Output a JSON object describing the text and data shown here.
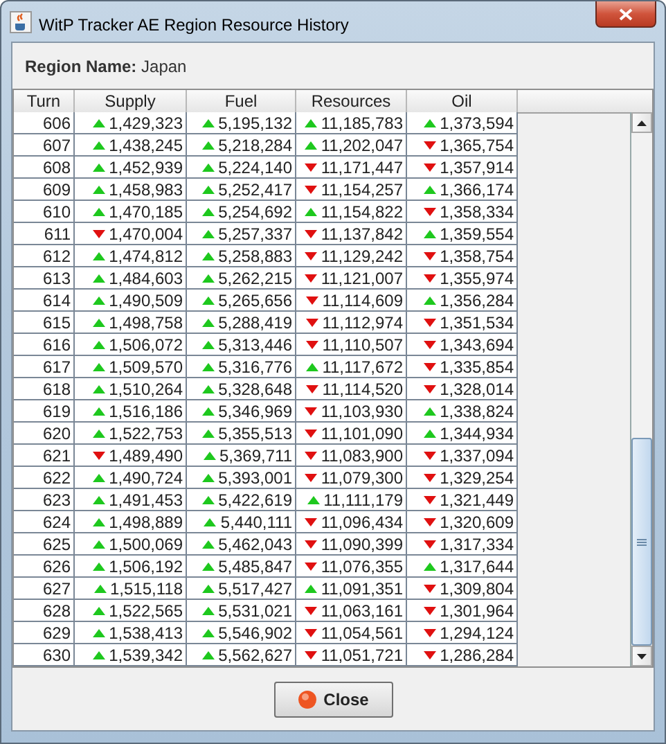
{
  "window": {
    "title": "WitP Tracker AE Region Resource History"
  },
  "region": {
    "label": "Region Name:",
    "value": "Japan"
  },
  "table": {
    "columns": [
      "Turn",
      "Supply",
      "Fuel",
      "Resources",
      "Oil"
    ],
    "rows": [
      {
        "cells": [
          {
            "value": "606"
          },
          {
            "value": "1,429,323",
            "rising": true
          },
          {
            "value": "5,195,132",
            "rising": true
          },
          {
            "value": "11,185,783",
            "rising": true
          },
          {
            "value": "1,373,594",
            "rising": true
          }
        ]
      },
      {
        "cells": [
          {
            "value": "607"
          },
          {
            "value": "1,438,245",
            "rising": true
          },
          {
            "value": "5,218,284",
            "rising": true
          },
          {
            "value": "11,202,047",
            "rising": true
          },
          {
            "value": "1,365,754",
            "rising": false
          }
        ]
      },
      {
        "cells": [
          {
            "value": "608"
          },
          {
            "value": "1,452,939",
            "rising": true
          },
          {
            "value": "5,224,140",
            "rising": true
          },
          {
            "value": "11,171,447",
            "rising": false
          },
          {
            "value": "1,357,914",
            "rising": false
          }
        ]
      },
      {
        "cells": [
          {
            "value": "609"
          },
          {
            "value": "1,458,983",
            "rising": true
          },
          {
            "value": "5,252,417",
            "rising": true
          },
          {
            "value": "11,154,257",
            "rising": false
          },
          {
            "value": "1,366,174",
            "rising": true
          }
        ]
      },
      {
        "cells": [
          {
            "value": "610"
          },
          {
            "value": "1,470,185",
            "rising": true
          },
          {
            "value": "5,254,692",
            "rising": true
          },
          {
            "value": "11,154,822",
            "rising": true
          },
          {
            "value": "1,358,334",
            "rising": false
          }
        ]
      },
      {
        "cells": [
          {
            "value": "611"
          },
          {
            "value": "1,470,004",
            "rising": false
          },
          {
            "value": "5,257,337",
            "rising": true
          },
          {
            "value": "11,137,842",
            "rising": false
          },
          {
            "value": "1,359,554",
            "rising": true
          }
        ]
      },
      {
        "cells": [
          {
            "value": "612"
          },
          {
            "value": "1,474,812",
            "rising": true
          },
          {
            "value": "5,258,883",
            "rising": true
          },
          {
            "value": "11,129,242",
            "rising": false
          },
          {
            "value": "1,358,754",
            "rising": false
          }
        ]
      },
      {
        "cells": [
          {
            "value": "613"
          },
          {
            "value": "1,484,603",
            "rising": true
          },
          {
            "value": "5,262,215",
            "rising": true
          },
          {
            "value": "11,121,007",
            "rising": false
          },
          {
            "value": "1,355,974",
            "rising": false
          }
        ]
      },
      {
        "cells": [
          {
            "value": "614"
          },
          {
            "value": "1,490,509",
            "rising": true
          },
          {
            "value": "5,265,656",
            "rising": true
          },
          {
            "value": "11,114,609",
            "rising": false
          },
          {
            "value": "1,356,284",
            "rising": true
          }
        ]
      },
      {
        "cells": [
          {
            "value": "615"
          },
          {
            "value": "1,498,758",
            "rising": true
          },
          {
            "value": "5,288,419",
            "rising": true
          },
          {
            "value": "11,112,974",
            "rising": false
          },
          {
            "value": "1,351,534",
            "rising": false
          }
        ]
      },
      {
        "cells": [
          {
            "value": "616"
          },
          {
            "value": "1,506,072",
            "rising": true
          },
          {
            "value": "5,313,446",
            "rising": true
          },
          {
            "value": "11,110,507",
            "rising": false
          },
          {
            "value": "1,343,694",
            "rising": false
          }
        ]
      },
      {
        "cells": [
          {
            "value": "617"
          },
          {
            "value": "1,509,570",
            "rising": true
          },
          {
            "value": "5,316,776",
            "rising": true
          },
          {
            "value": "11,117,672",
            "rising": true
          },
          {
            "value": "1,335,854",
            "rising": false
          }
        ]
      },
      {
        "cells": [
          {
            "value": "618"
          },
          {
            "value": "1,510,264",
            "rising": true
          },
          {
            "value": "5,328,648",
            "rising": true
          },
          {
            "value": "11,114,520",
            "rising": false
          },
          {
            "value": "1,328,014",
            "rising": false
          }
        ]
      },
      {
        "cells": [
          {
            "value": "619"
          },
          {
            "value": "1,516,186",
            "rising": true
          },
          {
            "value": "5,346,969",
            "rising": true
          },
          {
            "value": "11,103,930",
            "rising": false
          },
          {
            "value": "1,338,824",
            "rising": true
          }
        ]
      },
      {
        "cells": [
          {
            "value": "620"
          },
          {
            "value": "1,522,753",
            "rising": true
          },
          {
            "value": "5,355,513",
            "rising": true
          },
          {
            "value": "11,101,090",
            "rising": false
          },
          {
            "value": "1,344,934",
            "rising": true
          }
        ]
      },
      {
        "cells": [
          {
            "value": "621"
          },
          {
            "value": "1,489,490",
            "rising": false
          },
          {
            "value": "5,369,711",
            "rising": true
          },
          {
            "value": "11,083,900",
            "rising": false
          },
          {
            "value": "1,337,094",
            "rising": false
          }
        ]
      },
      {
        "cells": [
          {
            "value": "622"
          },
          {
            "value": "1,490,724",
            "rising": true
          },
          {
            "value": "5,393,001",
            "rising": true
          },
          {
            "value": "11,079,300",
            "rising": false
          },
          {
            "value": "1,329,254",
            "rising": false
          }
        ]
      },
      {
        "cells": [
          {
            "value": "623"
          },
          {
            "value": "1,491,453",
            "rising": true
          },
          {
            "value": "5,422,619",
            "rising": true
          },
          {
            "value": "11,111,179",
            "rising": true
          },
          {
            "value": "1,321,449",
            "rising": false
          }
        ]
      },
      {
        "cells": [
          {
            "value": "624"
          },
          {
            "value": "1,498,889",
            "rising": true
          },
          {
            "value": "5,440,111",
            "rising": true
          },
          {
            "value": "11,096,434",
            "rising": false
          },
          {
            "value": "1,320,609",
            "rising": false
          }
        ]
      },
      {
        "cells": [
          {
            "value": "625"
          },
          {
            "value": "1,500,069",
            "rising": true
          },
          {
            "value": "5,462,043",
            "rising": true
          },
          {
            "value": "11,090,399",
            "rising": false
          },
          {
            "value": "1,317,334",
            "rising": false
          }
        ]
      },
      {
        "cells": [
          {
            "value": "626"
          },
          {
            "value": "1,506,192",
            "rising": true
          },
          {
            "value": "5,485,847",
            "rising": true
          },
          {
            "value": "11,076,355",
            "rising": false
          },
          {
            "value": "1,317,644",
            "rising": true
          }
        ]
      },
      {
        "cells": [
          {
            "value": "627"
          },
          {
            "value": "1,515,118",
            "rising": true
          },
          {
            "value": "5,517,427",
            "rising": true
          },
          {
            "value": "11,091,351",
            "rising": true
          },
          {
            "value": "1,309,804",
            "rising": false
          }
        ]
      },
      {
        "cells": [
          {
            "value": "628"
          },
          {
            "value": "1,522,565",
            "rising": true
          },
          {
            "value": "5,531,021",
            "rising": true
          },
          {
            "value": "11,063,161",
            "rising": false
          },
          {
            "value": "1,301,964",
            "rising": false
          }
        ]
      },
      {
        "cells": [
          {
            "value": "629"
          },
          {
            "value": "1,538,413",
            "rising": true
          },
          {
            "value": "5,546,902",
            "rising": true
          },
          {
            "value": "11,054,561",
            "rising": false
          },
          {
            "value": "1,294,124",
            "rising": false
          }
        ]
      },
      {
        "cells": [
          {
            "value": "630"
          },
          {
            "value": "1,539,342",
            "rising": true
          },
          {
            "value": "5,562,627",
            "rising": true
          },
          {
            "value": "11,051,721",
            "rising": false
          },
          {
            "value": "1,286,284",
            "rising": false
          }
        ]
      }
    ]
  },
  "buttons": [
    {
      "label": "Close"
    }
  ]
}
